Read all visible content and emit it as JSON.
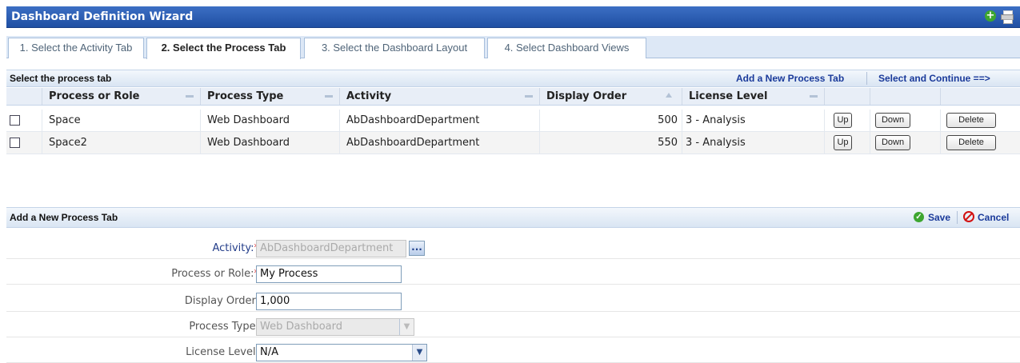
{
  "window": {
    "title": "Dashboard Definition Wizard",
    "icons": [
      "add-icon",
      "print-icon"
    ]
  },
  "tabs": [
    {
      "label": "1. Select the Activity Tab",
      "active": false
    },
    {
      "label": "2. Select the Process Tab",
      "active": true
    },
    {
      "label": "3. Select the Dashboard Layout",
      "active": false
    },
    {
      "label": "4. Select Dashboard Views",
      "active": false
    }
  ],
  "grid_section": {
    "title": "Select the process tab",
    "add_link": "Add a New Process Tab",
    "continue_link": "Select and Continue ==>"
  },
  "grid": {
    "columns": [
      "Process or Role",
      "Process Type",
      "Activity",
      "Display Order",
      "License Level"
    ],
    "rows": [
      {
        "process": "Space",
        "type": "Web Dashboard",
        "activity": "AbDashboardDepartment",
        "order": "500",
        "license": "3 - Analysis",
        "checked": false
      },
      {
        "process": "Space2",
        "type": "Web Dashboard",
        "activity": "AbDashboardDepartment",
        "order": "550",
        "license": "3 - Analysis",
        "checked": false
      }
    ],
    "buttons": {
      "up": "Up",
      "down": "Down",
      "delete": "Delete"
    }
  },
  "form_section": {
    "title": "Add a New Process Tab",
    "save": "Save",
    "cancel": "Cancel"
  },
  "form": {
    "activity": {
      "label": "Activity:",
      "required": "*",
      "value": "AbDashboardDepartment",
      "button": "..."
    },
    "process_or_role": {
      "label": "Process or Role:",
      "required": "*",
      "value": "My Process"
    },
    "display_order": {
      "label": "Display Order:",
      "value": "1,000"
    },
    "process_type": {
      "label": "Process Type:",
      "value": "Web Dashboard"
    },
    "license_level": {
      "label": "License Level:",
      "value": "N/A"
    }
  },
  "colors": {
    "title_bar": "#2a5cb4",
    "link": "#1a3a9a",
    "required": "#dd2222",
    "save_green": "#3da630",
    "cancel_red": "#d21010"
  }
}
